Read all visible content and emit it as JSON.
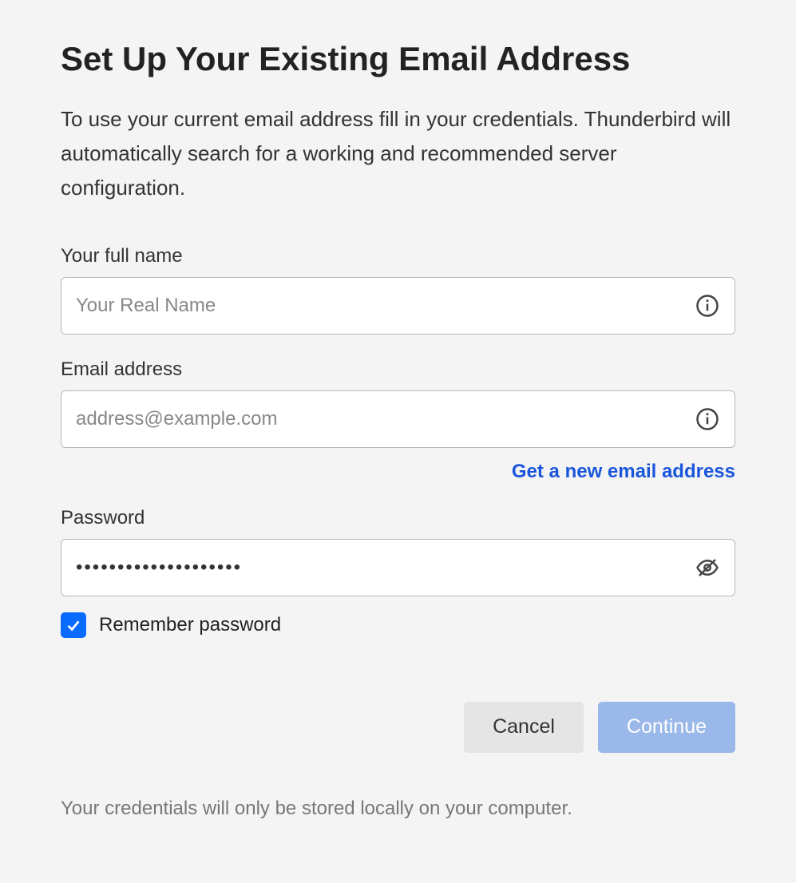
{
  "title": "Set Up Your Existing Email Address",
  "subtitle": "To use your current email address fill in your credentials. Thunderbird will automatically search for a working and recommended server configuration.",
  "fields": {
    "name": {
      "label": "Your full name",
      "placeholder": "Your Real Name",
      "value": ""
    },
    "email": {
      "label": "Email address",
      "placeholder": "address@example.com",
      "value": ""
    },
    "password": {
      "label": "Password",
      "placeholder": "",
      "value": "••••••••••••••••••••"
    }
  },
  "new_email_link": "Get a new email address",
  "remember": {
    "label": "Remember password",
    "checked": true
  },
  "buttons": {
    "cancel": "Cancel",
    "continue": "Continue"
  },
  "footer": "Your credentials will only be stored locally on your computer."
}
